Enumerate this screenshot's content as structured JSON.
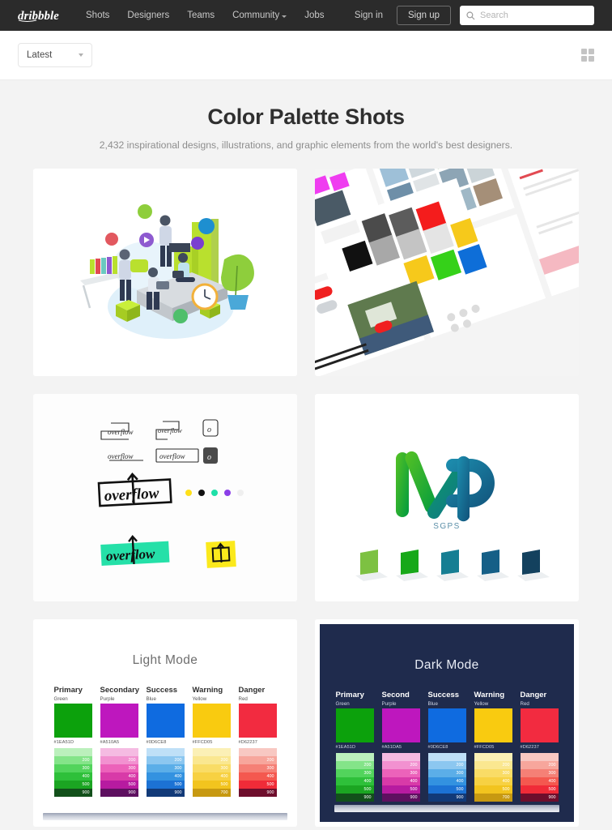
{
  "nav": {
    "logo_name": "dribbble-logo",
    "links": [
      {
        "label": "Shots",
        "has_chevron": false
      },
      {
        "label": "Designers",
        "has_chevron": false
      },
      {
        "label": "Teams",
        "has_chevron": false
      },
      {
        "label": "Community",
        "has_chevron": true
      },
      {
        "label": "Jobs",
        "has_chevron": false
      }
    ],
    "signin_label": "Sign in",
    "signup_label": "Sign up",
    "search_placeholder": "Search",
    "search_value": "",
    "bar_color": "#2b2b2b"
  },
  "subbar": {
    "sort_label": "Latest",
    "grid_view_name": "grid-view-icon"
  },
  "page": {
    "title": "Color Palette Shots",
    "subtitle": "2,432 inspirational designs, illustrations, and graphic elements from the world's best designers.",
    "count": "2,432"
  },
  "shots": [
    {
      "name": "shot-isometric-teamwork-illustration",
      "kind": "illustration"
    },
    {
      "name": "shot-ui-mockup-collage",
      "kind": "collage"
    },
    {
      "name": "shot-overflow-logo-variations",
      "kind": "overflow"
    },
    {
      "name": "shot-iap-sgps-logo",
      "kind": "iap"
    },
    {
      "name": "shot-light-mode-palette",
      "kind": "palette-light"
    },
    {
      "name": "shot-dark-mode-palette",
      "kind": "palette-dark"
    }
  ],
  "overflow_shot": {
    "wordmark": "overflow",
    "dots": [
      "#FFE01A",
      "#111111",
      "#1FE0A8",
      "#8B3FE8",
      "#EFEFEF"
    ]
  },
  "iap_shot": {
    "wordmark": "IAP",
    "subtitle": "SGPS",
    "chips": [
      "#7DC142",
      "#17A819",
      "#167E93",
      "#155F87",
      "#13415E"
    ]
  },
  "palettes": [
    {
      "mode_label": "Light Mode",
      "background": "#ffffff",
      "columns": [
        {
          "name": "Primary",
          "subname": "Green",
          "hex": "#1EA51D",
          "swatch": "#0CA10C",
          "ramp": [
            {
              "label": "",
              "color": "#BBF0BC"
            },
            {
              "label": "200",
              "color": "#84E489"
            },
            {
              "label": "300",
              "color": "#52D45C"
            },
            {
              "label": "400",
              "color": "#2EC03A"
            },
            {
              "label": "500",
              "color": "#1BA522"
            },
            {
              "label": "900",
              "color": "#12501A"
            }
          ]
        },
        {
          "name": "Secondary",
          "subname": "Purple",
          "hex": "#A510A5",
          "swatch": "#BE17BE",
          "ramp": [
            {
              "label": "",
              "color": "#F5BBE2"
            },
            {
              "label": "200",
              "color": "#F291D0"
            },
            {
              "label": "300",
              "color": "#EC62BA"
            },
            {
              "label": "400",
              "color": "#D83AA8"
            },
            {
              "label": "500",
              "color": "#B71BA0"
            },
            {
              "label": "900",
              "color": "#5E1060"
            }
          ]
        },
        {
          "name": "Success",
          "subname": "Blue",
          "hex": "#0D6CE8",
          "swatch": "#0F6BE0",
          "ramp": [
            {
              "label": "",
              "color": "#BFE0F7"
            },
            {
              "label": "200",
              "color": "#8CC7F0"
            },
            {
              "label": "300",
              "color": "#5BAEE8"
            },
            {
              "label": "400",
              "color": "#3392E0"
            },
            {
              "label": "500",
              "color": "#1C72D4"
            },
            {
              "label": "900",
              "color": "#123A78"
            }
          ]
        },
        {
          "name": "Warning",
          "subname": "Yellow",
          "hex": "#FFCD05",
          "swatch": "#F9CB10",
          "ramp": [
            {
              "label": "",
              "color": "#FBF0B6"
            },
            {
              "label": "200",
              "color": "#FAE790"
            },
            {
              "label": "300",
              "color": "#F9DC66"
            },
            {
              "label": "400",
              "color": "#F7D142"
            },
            {
              "label": "500",
              "color": "#F2C41E"
            },
            {
              "label": "700",
              "color": "#C79911"
            }
          ]
        },
        {
          "name": "Danger",
          "subname": "Red",
          "hex": "#D62237",
          "swatch": "#F22B40",
          "ramp": [
            {
              "label": "",
              "color": "#F8C8C2"
            },
            {
              "label": "200",
              "color": "#F7A69C"
            },
            {
              "label": "300",
              "color": "#F58076"
            },
            {
              "label": "400",
              "color": "#F4584F"
            },
            {
              "label": "500",
              "color": "#F02B38"
            },
            {
              "label": "900",
              "color": "#6E0E2C"
            }
          ]
        }
      ]
    },
    {
      "mode_label": "Dark Mode",
      "background": "#1f2b4d",
      "columns": [
        {
          "name": "Primary",
          "subname": "Green",
          "hex": "#1EA51D",
          "swatch": "#0CA10C",
          "ramp": [
            {
              "label": "",
              "color": "#BBF0BC"
            },
            {
              "label": "200",
              "color": "#84E489"
            },
            {
              "label": "300",
              "color": "#52D45C"
            },
            {
              "label": "400",
              "color": "#2EC03A"
            },
            {
              "label": "500",
              "color": "#1BA522"
            },
            {
              "label": "900",
              "color": "#12501A"
            }
          ]
        },
        {
          "name": "Second",
          "subname": "Purple",
          "hex": "#A51DA5",
          "swatch": "#BE17BE",
          "ramp": [
            {
              "label": "",
              "color": "#F5BBE2"
            },
            {
              "label": "200",
              "color": "#F291D0"
            },
            {
              "label": "300",
              "color": "#EC62BA"
            },
            {
              "label": "400",
              "color": "#D83AA8"
            },
            {
              "label": "500",
              "color": "#B71BA0"
            },
            {
              "label": "900",
              "color": "#5E1060"
            }
          ]
        },
        {
          "name": "Success",
          "subname": "Blue",
          "hex": "#0D6CE8",
          "swatch": "#0F6BE0",
          "ramp": [
            {
              "label": "",
              "color": "#BFE0F7"
            },
            {
              "label": "200",
              "color": "#8CC7F0"
            },
            {
              "label": "300",
              "color": "#5BAEE8"
            },
            {
              "label": "400",
              "color": "#3392E0"
            },
            {
              "label": "500",
              "color": "#1C72D4"
            },
            {
              "label": "900",
              "color": "#123A78"
            }
          ]
        },
        {
          "name": "Warning",
          "subname": "Yellow",
          "hex": "#FFCD05",
          "swatch": "#F9CB10",
          "ramp": [
            {
              "label": "",
              "color": "#FBF0B6"
            },
            {
              "label": "200",
              "color": "#FAE790"
            },
            {
              "label": "300",
              "color": "#F9DC66"
            },
            {
              "label": "400",
              "color": "#F7D142"
            },
            {
              "label": "500",
              "color": "#F2C41E"
            },
            {
              "label": "700",
              "color": "#C79911"
            }
          ]
        },
        {
          "name": "Danger",
          "subname": "Red",
          "hex": "#D62237",
          "swatch": "#F22B40",
          "ramp": [
            {
              "label": "",
              "color": "#F8C8C2"
            },
            {
              "label": "200",
              "color": "#F7A69C"
            },
            {
              "label": "300",
              "color": "#F58076"
            },
            {
              "label": "400",
              "color": "#F4584F"
            },
            {
              "label": "500",
              "color": "#F02B38"
            },
            {
              "label": "900",
              "color": "#6E0E2C"
            }
          ]
        }
      ]
    }
  ]
}
